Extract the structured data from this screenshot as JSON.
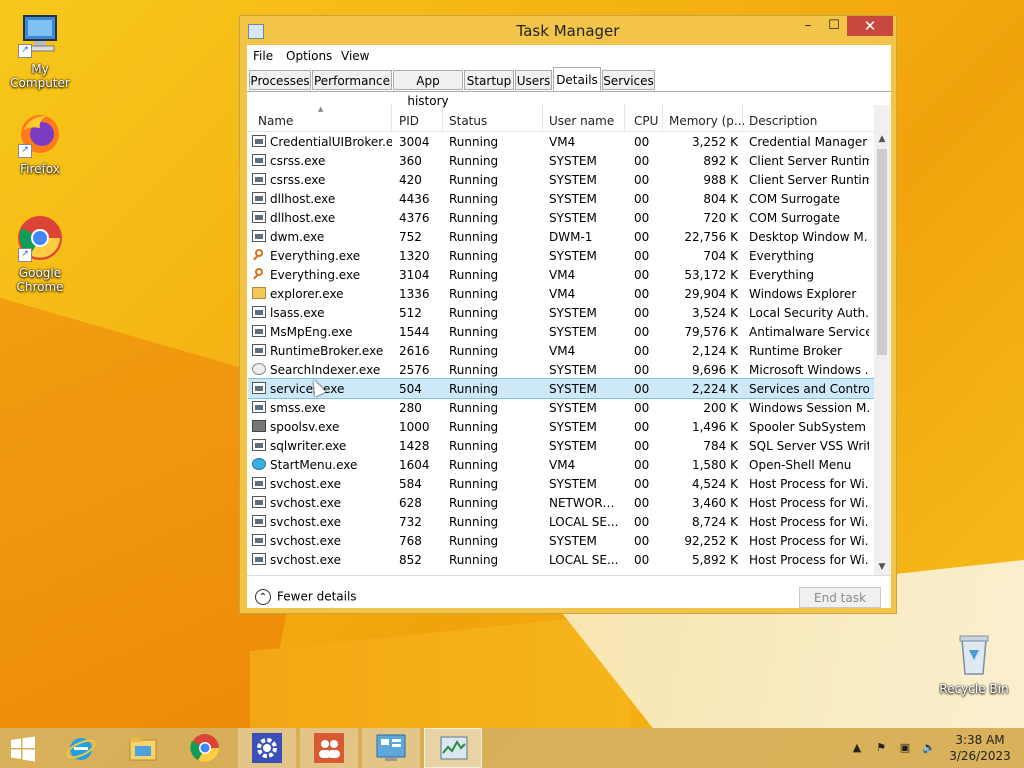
{
  "desktop": {
    "icons": [
      {
        "label": "My Computer"
      },
      {
        "label": "Firefox"
      },
      {
        "label": "Google Chrome"
      },
      {
        "label": "Recycle Bin"
      }
    ]
  },
  "window": {
    "title": "Task Manager",
    "controls": {
      "minimize": "–",
      "maximize": "☐",
      "close": "✕"
    }
  },
  "menu": [
    "File",
    "Options",
    "View"
  ],
  "tabs": [
    "Processes",
    "Performance",
    "App history",
    "Startup",
    "Users",
    "Details",
    "Services"
  ],
  "active_tab": "Details",
  "columns": [
    "Name",
    "PID",
    "Status",
    "User name",
    "CPU",
    "Memory (p...",
    "Description"
  ],
  "rows": [
    {
      "icon": "exe-icon",
      "name": "CredentialUIBroker.exe",
      "pid": "3004",
      "status": "Running",
      "user": "VM4",
      "cpu": "00",
      "mem": "3,252 K",
      "desc": "Credential Manager ..."
    },
    {
      "icon": "exe-icon",
      "name": "csrss.exe",
      "pid": "360",
      "status": "Running",
      "user": "SYSTEM",
      "cpu": "00",
      "mem": "892 K",
      "desc": "Client Server Runtim..."
    },
    {
      "icon": "exe-icon",
      "name": "csrss.exe",
      "pid": "420",
      "status": "Running",
      "user": "SYSTEM",
      "cpu": "00",
      "mem": "988 K",
      "desc": "Client Server Runtim..."
    },
    {
      "icon": "exe-icon",
      "name": "dllhost.exe",
      "pid": "4436",
      "status": "Running",
      "user": "SYSTEM",
      "cpu": "00",
      "mem": "804 K",
      "desc": "COM Surrogate"
    },
    {
      "icon": "exe-icon",
      "name": "dllhost.exe",
      "pid": "4376",
      "status": "Running",
      "user": "SYSTEM",
      "cpu": "00",
      "mem": "720 K",
      "desc": "COM Surrogate"
    },
    {
      "icon": "exe-icon",
      "name": "dwm.exe",
      "pid": "752",
      "status": "Running",
      "user": "DWM-1",
      "cpu": "00",
      "mem": "22,756 K",
      "desc": "Desktop Window M..."
    },
    {
      "icon": "search-icon",
      "name": "Everything.exe",
      "pid": "1320",
      "status": "Running",
      "user": "SYSTEM",
      "cpu": "00",
      "mem": "704 K",
      "desc": "Everything"
    },
    {
      "icon": "search-icon",
      "name": "Everything.exe",
      "pid": "3104",
      "status": "Running",
      "user": "VM4",
      "cpu": "00",
      "mem": "53,172 K",
      "desc": "Everything"
    },
    {
      "icon": "explorer-icon",
      "name": "explorer.exe",
      "pid": "1336",
      "status": "Running",
      "user": "VM4",
      "cpu": "00",
      "mem": "29,904 K",
      "desc": "Windows Explorer"
    },
    {
      "icon": "exe-icon",
      "name": "lsass.exe",
      "pid": "512",
      "status": "Running",
      "user": "SYSTEM",
      "cpu": "00",
      "mem": "3,524 K",
      "desc": "Local Security Auth..."
    },
    {
      "icon": "exe-icon",
      "name": "MsMpEng.exe",
      "pid": "1544",
      "status": "Running",
      "user": "SYSTEM",
      "cpu": "00",
      "mem": "79,576 K",
      "desc": "Antimalware Service..."
    },
    {
      "icon": "exe-icon",
      "name": "RuntimeBroker.exe",
      "pid": "2616",
      "status": "Running",
      "user": "VM4",
      "cpu": "00",
      "mem": "2,124 K",
      "desc": "Runtime Broker"
    },
    {
      "icon": "indexer-icon",
      "name": "SearchIndexer.exe",
      "pid": "2576",
      "status": "Running",
      "user": "SYSTEM",
      "cpu": "00",
      "mem": "9,696 K",
      "desc": "Microsoft Windows ..."
    },
    {
      "icon": "exe-icon",
      "name": "services.exe",
      "pid": "504",
      "status": "Running",
      "user": "SYSTEM",
      "cpu": "00",
      "mem": "2,224 K",
      "desc": "Services and Control..."
    },
    {
      "icon": "exe-icon",
      "name": "smss.exe",
      "pid": "280",
      "status": "Running",
      "user": "SYSTEM",
      "cpu": "00",
      "mem": "200 K",
      "desc": "Windows Session M..."
    },
    {
      "icon": "printer-icon",
      "name": "spoolsv.exe",
      "pid": "1000",
      "status": "Running",
      "user": "SYSTEM",
      "cpu": "00",
      "mem": "1,496 K",
      "desc": "Spooler SubSystem ..."
    },
    {
      "icon": "exe-icon",
      "name": "sqlwriter.exe",
      "pid": "1428",
      "status": "Running",
      "user": "SYSTEM",
      "cpu": "00",
      "mem": "784 K",
      "desc": "SQL Server VSS Writ..."
    },
    {
      "icon": "shell-icon",
      "name": "StartMenu.exe",
      "pid": "1604",
      "status": "Running",
      "user": "VM4",
      "cpu": "00",
      "mem": "1,580 K",
      "desc": "Open-Shell Menu"
    },
    {
      "icon": "exe-icon",
      "name": "svchost.exe",
      "pid": "584",
      "status": "Running",
      "user": "SYSTEM",
      "cpu": "00",
      "mem": "4,524 K",
      "desc": "Host Process for Wi..."
    },
    {
      "icon": "exe-icon",
      "name": "svchost.exe",
      "pid": "628",
      "status": "Running",
      "user": "NETWORK...",
      "cpu": "00",
      "mem": "3,460 K",
      "desc": "Host Process for Wi..."
    },
    {
      "icon": "exe-icon",
      "name": "svchost.exe",
      "pid": "732",
      "status": "Running",
      "user": "LOCAL SE...",
      "cpu": "00",
      "mem": "8,724 K",
      "desc": "Host Process for Wi..."
    },
    {
      "icon": "exe-icon",
      "name": "svchost.exe",
      "pid": "768",
      "status": "Running",
      "user": "SYSTEM",
      "cpu": "00",
      "mem": "92,252 K",
      "desc": "Host Process for Wi..."
    },
    {
      "icon": "exe-icon",
      "name": "svchost.exe",
      "pid": "852",
      "status": "Running",
      "user": "LOCAL SE...",
      "cpu": "00",
      "mem": "5,892 K",
      "desc": "Host Process for Wi..."
    }
  ],
  "selected_row": 13,
  "footer": {
    "fewer_details": "Fewer details",
    "end_task": "End task"
  },
  "taskbar": {
    "items": [
      {
        "icon": "windows-start-icon",
        "open": false
      },
      {
        "icon": "internet-explorer-icon",
        "open": false
      },
      {
        "icon": "file-explorer-icon",
        "open": false
      },
      {
        "icon": "chrome-icon",
        "open": false
      },
      {
        "icon": "settings-gear-icon",
        "open": true
      },
      {
        "icon": "users-icon",
        "open": true
      },
      {
        "icon": "control-panel-icon",
        "open": true
      },
      {
        "icon": "task-manager-icon",
        "open": true,
        "active": true
      }
    ],
    "clock": {
      "time": "3:38 AM",
      "date": "3/26/2023"
    }
  },
  "colors": {
    "accent": "#f2c548",
    "selection": "#cde8f7",
    "close": "#c7483f"
  }
}
